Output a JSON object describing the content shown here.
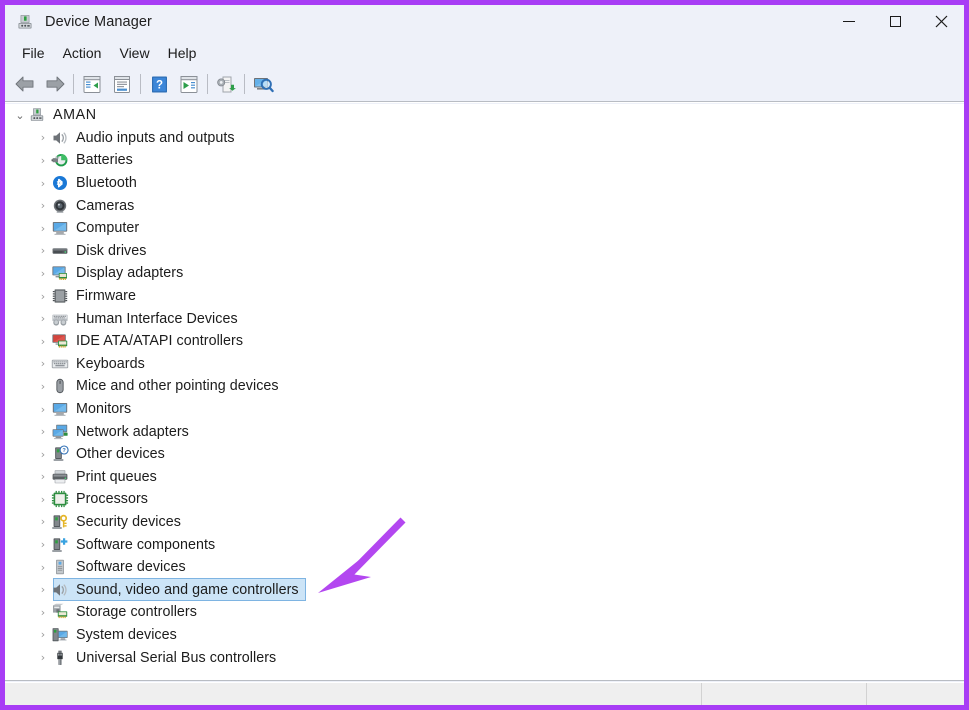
{
  "window": {
    "title": "Device Manager",
    "title_icon": "device-manager-icon",
    "frame_color": "#a83df5",
    "controls": {
      "minimize_label": "Minimize",
      "maximize_label": "Maximize",
      "close_label": "Close"
    }
  },
  "menubar": {
    "items": [
      {
        "label": "File",
        "name": "menu-file"
      },
      {
        "label": "Action",
        "name": "menu-action"
      },
      {
        "label": "View",
        "name": "menu-view"
      },
      {
        "label": "Help",
        "name": "menu-help"
      }
    ]
  },
  "toolbar": {
    "buttons": [
      {
        "name": "back-button",
        "icon": "back-arrow-icon",
        "tooltip": "Back"
      },
      {
        "name": "forward-button",
        "icon": "forward-arrow-icon",
        "tooltip": "Forward"
      },
      {
        "name": "separator-1",
        "icon": "separator",
        "tooltip": ""
      },
      {
        "name": "show-hide-console-tree-button",
        "icon": "console-tree-icon",
        "tooltip": "Show/Hide Console Tree"
      },
      {
        "name": "properties-button",
        "icon": "properties-icon",
        "tooltip": "Properties"
      },
      {
        "name": "separator-2",
        "icon": "separator",
        "tooltip": ""
      },
      {
        "name": "help-button",
        "icon": "help-question-icon",
        "tooltip": "Help"
      },
      {
        "name": "action-button",
        "icon": "action-play-icon",
        "tooltip": "Action"
      },
      {
        "name": "separator-3",
        "icon": "separator",
        "tooltip": ""
      },
      {
        "name": "update-driver-button",
        "icon": "update-driver-icon",
        "tooltip": "Update driver"
      },
      {
        "name": "separator-4",
        "icon": "separator",
        "tooltip": ""
      },
      {
        "name": "scan-hardware-changes-button",
        "icon": "scan-hardware-icon",
        "tooltip": "Scan for hardware changes"
      }
    ]
  },
  "tree": {
    "root": {
      "label": "AMAN",
      "icon": "computer-device-icon",
      "expanded": true,
      "chevron": "⌄"
    },
    "chevron_collapsed": "›",
    "items": [
      {
        "label": "Audio inputs and outputs",
        "icon": "speaker-icon",
        "selected": false
      },
      {
        "label": "Batteries",
        "icon": "battery-icon",
        "selected": false
      },
      {
        "label": "Bluetooth",
        "icon": "bluetooth-icon",
        "selected": false
      },
      {
        "label": "Cameras",
        "icon": "camera-icon",
        "selected": false
      },
      {
        "label": "Computer",
        "icon": "monitor-icon",
        "selected": false
      },
      {
        "label": "Disk drives",
        "icon": "disk-drive-icon",
        "selected": false
      },
      {
        "label": "Display adapters",
        "icon": "display-adapter-icon",
        "selected": false
      },
      {
        "label": "Firmware",
        "icon": "firmware-chip-icon",
        "selected": false
      },
      {
        "label": "Human Interface Devices",
        "icon": "hid-icon",
        "selected": false
      },
      {
        "label": "IDE ATA/ATAPI controllers",
        "icon": "ide-controller-icon",
        "selected": false
      },
      {
        "label": "Keyboards",
        "icon": "keyboard-icon",
        "selected": false
      },
      {
        "label": "Mice and other pointing devices",
        "icon": "mouse-icon",
        "selected": false
      },
      {
        "label": "Monitors",
        "icon": "monitor-icon",
        "selected": false
      },
      {
        "label": "Network adapters",
        "icon": "network-adapter-icon",
        "selected": false
      },
      {
        "label": "Other devices",
        "icon": "other-device-icon",
        "selected": false
      },
      {
        "label": "Print queues",
        "icon": "printer-icon",
        "selected": false
      },
      {
        "label": "Processors",
        "icon": "processor-icon",
        "selected": false
      },
      {
        "label": "Security devices",
        "icon": "security-device-icon",
        "selected": false
      },
      {
        "label": "Software components",
        "icon": "software-component-icon",
        "selected": false
      },
      {
        "label": "Software devices",
        "icon": "software-device-icon",
        "selected": false
      },
      {
        "label": "Sound, video and game controllers",
        "icon": "speaker-icon",
        "selected": true
      },
      {
        "label": "Storage controllers",
        "icon": "storage-controller-icon",
        "selected": false
      },
      {
        "label": "System devices",
        "icon": "system-device-icon",
        "selected": false
      },
      {
        "label": "Universal Serial Bus controllers",
        "icon": "usb-icon",
        "selected": false
      }
    ]
  },
  "statusbar": {
    "cells": [
      "",
      "",
      ""
    ]
  },
  "annotation": {
    "arrow": {
      "name": "annotation-arrow",
      "color": "#b347f0",
      "points_to": "Sound, video and game controllers"
    }
  },
  "colors": {
    "selection_fill": "#cce4f7",
    "selection_border": "#7eb4e2",
    "chrome": "#eef1f9",
    "accent": "#a83df5"
  }
}
